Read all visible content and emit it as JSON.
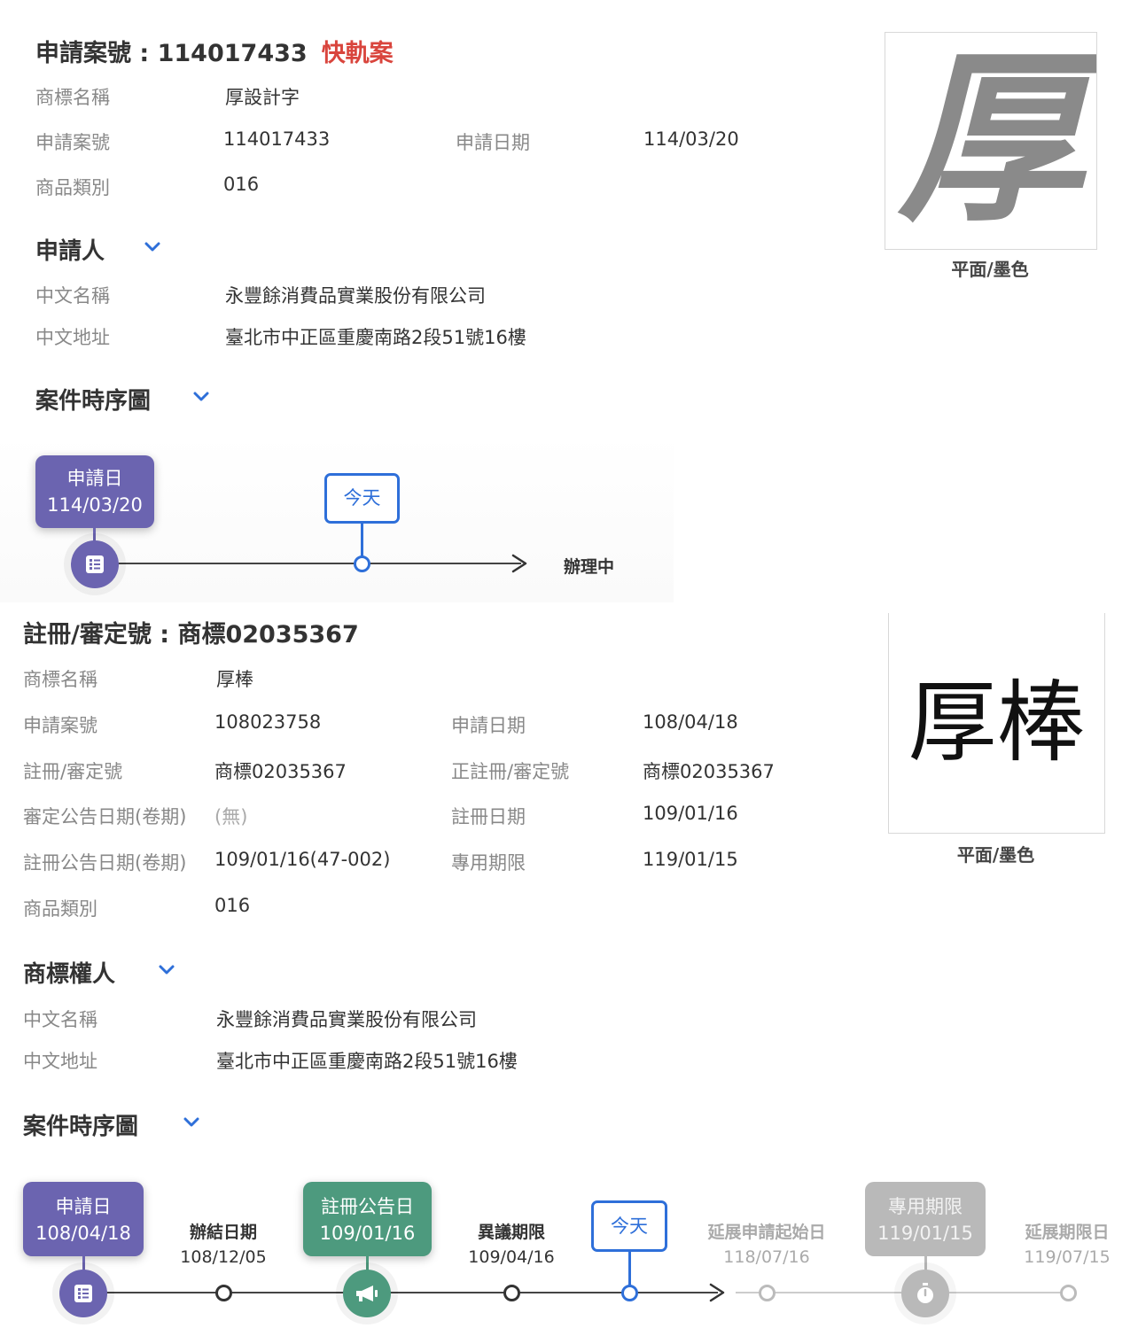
{
  "case1": {
    "title_prefix": "申請案號 : 114017433",
    "title_tag": "快軌案",
    "fields": {
      "trademark_name_label": "商標名稱",
      "trademark_name": "厚設計字",
      "app_no_label": "申請案號",
      "app_no": "114017433",
      "app_date_label": "申請日期",
      "app_date": "114/03/20",
      "goods_class_label": "商品類別",
      "goods_class": "016"
    },
    "applicant": {
      "heading": "申請人",
      "cn_name_label": "中文名稱",
      "cn_name": "永豐餘消費品實業股份有限公司",
      "cn_addr_label": "中文地址",
      "cn_addr": "臺北市中正區重慶南路2段51號16樓"
    },
    "image_caption": "平面/墨色",
    "image_glyph": "厚",
    "timeline": {
      "heading": "案件時序圖",
      "apply_label": "申請日",
      "apply_date": "114/03/20",
      "today_label": "今天",
      "status": "辦理中"
    }
  },
  "case2": {
    "title": "註冊/審定號 : 商標02035367",
    "fields": {
      "trademark_name_label": "商標名稱",
      "trademark_name": "厚棒",
      "app_no_label": "申請案號",
      "app_no": "108023758",
      "app_date_label": "申請日期",
      "app_date": "108/04/18",
      "reg_no_label": "註冊/審定號",
      "reg_no": "商標02035367",
      "formal_reg_no_label": "正註冊/審定號",
      "formal_reg_no": "商標02035367",
      "approval_pub_label": "審定公告日期(卷期)",
      "approval_pub": "(無)",
      "reg_date_label": "註冊日期",
      "reg_date": "109/01/16",
      "reg_pub_label": "註冊公告日期(卷期)",
      "reg_pub": "109/01/16(47-002)",
      "exclusive_label": "專用期限",
      "exclusive": "119/01/15",
      "goods_class_label": "商品類別",
      "goods_class": "016"
    },
    "owner": {
      "heading": "商標權人",
      "cn_name_label": "中文名稱",
      "cn_name": "永豐餘消費品實業股份有限公司",
      "cn_addr_label": "中文地址",
      "cn_addr": "臺北市中正區重慶南路2段51號16樓"
    },
    "image_caption": "平面/墨色",
    "image_text": "厚棒",
    "timeline": {
      "heading": "案件時序圖",
      "apply_label": "申請日",
      "apply_date": "108/04/18",
      "close_label": "辦結日期",
      "close_date": "108/12/05",
      "reg_pub_label": "註冊公告日",
      "reg_pub_date": "109/01/16",
      "opposition_label": "異議期限",
      "opposition_date": "109/04/16",
      "today_label": "今天",
      "renew_start_label": "延展申請起始日",
      "renew_start_date": "118/07/16",
      "exclusive_label": "專用期限",
      "exclusive_date": "119/01/15",
      "renew_end_label": "延展期限日",
      "renew_end_date": "119/07/15"
    }
  },
  "colors": {
    "accent_blue": "#2e6fd9",
    "fast_red": "#d9453d",
    "purple": "#6b64b0",
    "green": "#4d9a7e",
    "gray": "#b9b9b9"
  },
  "icons": [
    "chevron-down-icon",
    "list-icon",
    "megaphone-icon",
    "stopwatch-icon",
    "arrow-right-icon"
  ]
}
